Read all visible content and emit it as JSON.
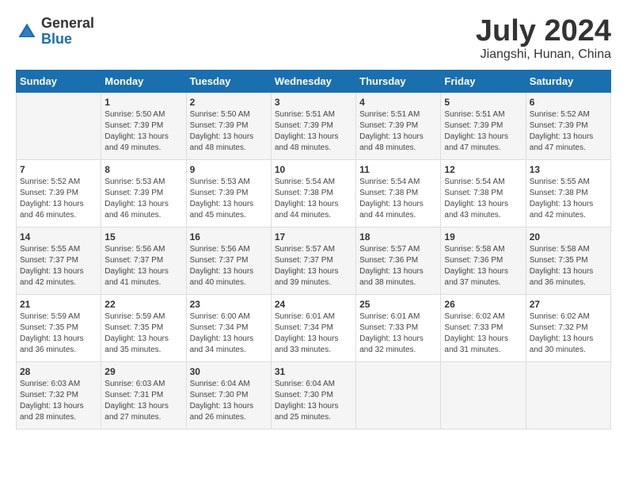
{
  "header": {
    "logo_general": "General",
    "logo_blue": "Blue",
    "month_title": "July 2024",
    "location": "Jiangshi, Hunan, China"
  },
  "days_of_week": [
    "Sunday",
    "Monday",
    "Tuesday",
    "Wednesday",
    "Thursday",
    "Friday",
    "Saturday"
  ],
  "weeks": [
    [
      {
        "day": "",
        "info": ""
      },
      {
        "day": "1",
        "info": "Sunrise: 5:50 AM\nSunset: 7:39 PM\nDaylight: 13 hours\nand 49 minutes."
      },
      {
        "day": "2",
        "info": "Sunrise: 5:50 AM\nSunset: 7:39 PM\nDaylight: 13 hours\nand 48 minutes."
      },
      {
        "day": "3",
        "info": "Sunrise: 5:51 AM\nSunset: 7:39 PM\nDaylight: 13 hours\nand 48 minutes."
      },
      {
        "day": "4",
        "info": "Sunrise: 5:51 AM\nSunset: 7:39 PM\nDaylight: 13 hours\nand 48 minutes."
      },
      {
        "day": "5",
        "info": "Sunrise: 5:51 AM\nSunset: 7:39 PM\nDaylight: 13 hours\nand 47 minutes."
      },
      {
        "day": "6",
        "info": "Sunrise: 5:52 AM\nSunset: 7:39 PM\nDaylight: 13 hours\nand 47 minutes."
      }
    ],
    [
      {
        "day": "7",
        "info": "Sunrise: 5:52 AM\nSunset: 7:39 PM\nDaylight: 13 hours\nand 46 minutes."
      },
      {
        "day": "8",
        "info": "Sunrise: 5:53 AM\nSunset: 7:39 PM\nDaylight: 13 hours\nand 46 minutes."
      },
      {
        "day": "9",
        "info": "Sunrise: 5:53 AM\nSunset: 7:39 PM\nDaylight: 13 hours\nand 45 minutes."
      },
      {
        "day": "10",
        "info": "Sunrise: 5:54 AM\nSunset: 7:38 PM\nDaylight: 13 hours\nand 44 minutes."
      },
      {
        "day": "11",
        "info": "Sunrise: 5:54 AM\nSunset: 7:38 PM\nDaylight: 13 hours\nand 44 minutes."
      },
      {
        "day": "12",
        "info": "Sunrise: 5:54 AM\nSunset: 7:38 PM\nDaylight: 13 hours\nand 43 minutes."
      },
      {
        "day": "13",
        "info": "Sunrise: 5:55 AM\nSunset: 7:38 PM\nDaylight: 13 hours\nand 42 minutes."
      }
    ],
    [
      {
        "day": "14",
        "info": "Sunrise: 5:55 AM\nSunset: 7:37 PM\nDaylight: 13 hours\nand 42 minutes."
      },
      {
        "day": "15",
        "info": "Sunrise: 5:56 AM\nSunset: 7:37 PM\nDaylight: 13 hours\nand 41 minutes."
      },
      {
        "day": "16",
        "info": "Sunrise: 5:56 AM\nSunset: 7:37 PM\nDaylight: 13 hours\nand 40 minutes."
      },
      {
        "day": "17",
        "info": "Sunrise: 5:57 AM\nSunset: 7:37 PM\nDaylight: 13 hours\nand 39 minutes."
      },
      {
        "day": "18",
        "info": "Sunrise: 5:57 AM\nSunset: 7:36 PM\nDaylight: 13 hours\nand 38 minutes."
      },
      {
        "day": "19",
        "info": "Sunrise: 5:58 AM\nSunset: 7:36 PM\nDaylight: 13 hours\nand 37 minutes."
      },
      {
        "day": "20",
        "info": "Sunrise: 5:58 AM\nSunset: 7:35 PM\nDaylight: 13 hours\nand 36 minutes."
      }
    ],
    [
      {
        "day": "21",
        "info": "Sunrise: 5:59 AM\nSunset: 7:35 PM\nDaylight: 13 hours\nand 36 minutes."
      },
      {
        "day": "22",
        "info": "Sunrise: 5:59 AM\nSunset: 7:35 PM\nDaylight: 13 hours\nand 35 minutes."
      },
      {
        "day": "23",
        "info": "Sunrise: 6:00 AM\nSunset: 7:34 PM\nDaylight: 13 hours\nand 34 minutes."
      },
      {
        "day": "24",
        "info": "Sunrise: 6:01 AM\nSunset: 7:34 PM\nDaylight: 13 hours\nand 33 minutes."
      },
      {
        "day": "25",
        "info": "Sunrise: 6:01 AM\nSunset: 7:33 PM\nDaylight: 13 hours\nand 32 minutes."
      },
      {
        "day": "26",
        "info": "Sunrise: 6:02 AM\nSunset: 7:33 PM\nDaylight: 13 hours\nand 31 minutes."
      },
      {
        "day": "27",
        "info": "Sunrise: 6:02 AM\nSunset: 7:32 PM\nDaylight: 13 hours\nand 30 minutes."
      }
    ],
    [
      {
        "day": "28",
        "info": "Sunrise: 6:03 AM\nSunset: 7:32 PM\nDaylight: 13 hours\nand 28 minutes."
      },
      {
        "day": "29",
        "info": "Sunrise: 6:03 AM\nSunset: 7:31 PM\nDaylight: 13 hours\nand 27 minutes."
      },
      {
        "day": "30",
        "info": "Sunrise: 6:04 AM\nSunset: 7:30 PM\nDaylight: 13 hours\nand 26 minutes."
      },
      {
        "day": "31",
        "info": "Sunrise: 6:04 AM\nSunset: 7:30 PM\nDaylight: 13 hours\nand 25 minutes."
      },
      {
        "day": "",
        "info": ""
      },
      {
        "day": "",
        "info": ""
      },
      {
        "day": "",
        "info": ""
      }
    ]
  ]
}
